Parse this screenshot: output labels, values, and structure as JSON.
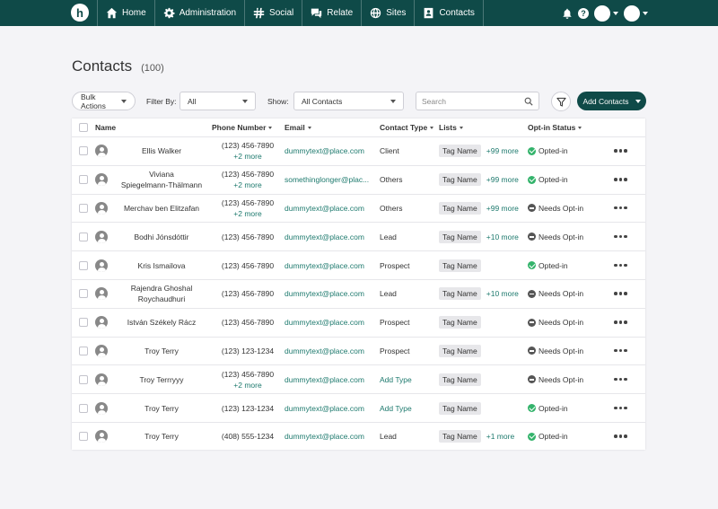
{
  "nav": {
    "logo": "h",
    "items": [
      {
        "label": "Home",
        "icon": "home-icon"
      },
      {
        "label": "Administration",
        "icon": "gear-icon"
      },
      {
        "label": "Social",
        "icon": "hash-icon"
      },
      {
        "label": "Relate",
        "icon": "chat-icon"
      },
      {
        "label": "Sites",
        "icon": "globe-icon"
      },
      {
        "label": "Contacts",
        "icon": "contact-card-icon"
      }
    ],
    "help": "?"
  },
  "page": {
    "title": "Contacts",
    "count": "(100)"
  },
  "filters": {
    "bulk_actions": "Bulk Actions",
    "filter_by_label": "Filter By:",
    "filter_by_value": "All",
    "show_label": "Show:",
    "show_value": "All Contacts",
    "search_placeholder": "Search",
    "add_contacts": "Add Contacts"
  },
  "table": {
    "headers": {
      "name": "Name",
      "phone": "Phone Number",
      "email": "Email",
      "type": "Contact Type",
      "lists": "Lists",
      "optin": "Opt-in Status"
    },
    "rows": [
      {
        "name1": "Ellis Walker",
        "name2": "",
        "phone": "(123) 456-7890",
        "phone_more": "+2 more",
        "email": "dummytext@place.com",
        "type": "Client",
        "tag": "Tag Name",
        "tag_more": "+99 more",
        "status": "Opted-in",
        "opted": true
      },
      {
        "name1": "Viviana",
        "name2": "Spiegelmann-Thälmann",
        "phone": "(123) 456-7890",
        "phone_more": "+2 more",
        "email": "somethinglonger@plac...",
        "type": "Others",
        "tag": "Tag Name",
        "tag_more": "+99 more",
        "status": "Opted-in",
        "opted": true
      },
      {
        "name1": "Merchav ben Elitzafan",
        "name2": "",
        "phone": "(123) 456-7890",
        "phone_more": "+2 more",
        "email": "dummytext@place.com",
        "type": "Others",
        "tag": "Tag Name",
        "tag_more": "+99 more",
        "status": "Needs Opt-in",
        "opted": false
      },
      {
        "name1": "Bodhi Jónsdóttir",
        "name2": "",
        "phone": "(123) 456-7890",
        "phone_more": "",
        "email": "dummytext@place.com",
        "type": "Lead",
        "tag": "Tag Name",
        "tag_more": "+10 more",
        "status": "Needs Opt-in",
        "opted": false
      },
      {
        "name1": "Kris Ismailova",
        "name2": "",
        "phone": "(123) 456-7890",
        "phone_more": "",
        "email": "dummytext@place.com",
        "type": "Prospect",
        "tag": "Tag Name",
        "tag_more": "",
        "status": "Opted-in",
        "opted": true
      },
      {
        "name1": "Rajendra Ghoshal",
        "name2": "Roychaudhuri",
        "phone": "(123) 456-7890",
        "phone_more": "",
        "email": "dummytext@place.com",
        "type": "Lead",
        "tag": "Tag Name",
        "tag_more": "+10 more",
        "status": "Needs Opt-in",
        "opted": false
      },
      {
        "name1": "István Székely Rácz",
        "name2": "",
        "phone": "(123) 456-7890",
        "phone_more": "",
        "email": "dummytext@place.com",
        "type": "Prospect",
        "tag": "Tag Name",
        "tag_more": "",
        "status": "Needs Opt-in",
        "opted": false
      },
      {
        "name1": "Troy Terry",
        "name2": "",
        "phone": "(123) 123-1234",
        "phone_more": "",
        "email": "dummytext@place.com",
        "type": "Prospect",
        "tag": "Tag Name",
        "tag_more": "",
        "status": "Needs Opt-in",
        "opted": false
      },
      {
        "name1": "Troy Terrryyy",
        "name2": "",
        "phone": "(123) 456-7890",
        "phone_more": "+2 more",
        "email": "dummytext@place.com",
        "type": "Add Type",
        "type_link": true,
        "tag": "Tag Name",
        "tag_more": "",
        "status": "Needs Opt-in",
        "opted": false
      },
      {
        "name1": "Troy Terry",
        "name2": "",
        "phone": "(123) 123-1234",
        "phone_more": "",
        "email": "dummytext@place.com",
        "type": "Add Type",
        "type_link": true,
        "tag": "Tag Name",
        "tag_more": "",
        "status": "Opted-in",
        "opted": true
      },
      {
        "name1": "Troy Terry",
        "name2": "",
        "phone": "(408) 555-1234",
        "phone_more": "",
        "email": "dummytext@place.com",
        "type": "Lead",
        "tag": "Tag Name",
        "tag_more": "+1  more",
        "status": "Opted-in",
        "opted": true
      }
    ]
  },
  "colors": {
    "brand": "#0f4a48",
    "link": "#1e7a6e",
    "opted": "#33b36b",
    "needs": "#555555"
  }
}
